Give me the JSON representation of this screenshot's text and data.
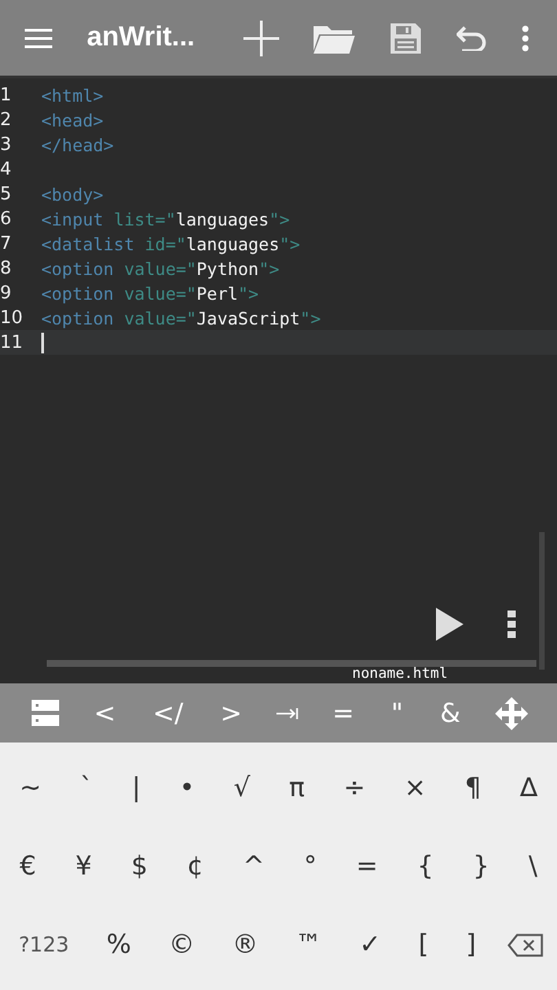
{
  "toolbar": {
    "title": "anWrit..."
  },
  "editor": {
    "lines": [
      {
        "number": "1",
        "current": false,
        "tokens": [
          {
            "kind": "tag",
            "text": "<html>"
          }
        ]
      },
      {
        "number": "2",
        "current": false,
        "tokens": [
          {
            "kind": "tag",
            "text": "<head>"
          }
        ]
      },
      {
        "number": "3",
        "current": false,
        "tokens": [
          {
            "kind": "tag",
            "text": "</head>"
          }
        ]
      },
      {
        "number": "4",
        "current": false
      },
      {
        "number": "5",
        "current": false,
        "tokens": [
          {
            "kind": "tag",
            "text": "<body>"
          }
        ]
      },
      {
        "number": "6",
        "current": false,
        "tokens": [
          {
            "kind": "tag",
            "text": "<input "
          },
          {
            "kind": "attr",
            "text": "list=\""
          },
          {
            "kind": "string",
            "text": "languages"
          },
          {
            "kind": "attr",
            "text": "\">"
          }
        ]
      },
      {
        "number": "7",
        "current": false,
        "tokens": [
          {
            "kind": "tag",
            "text": "<datalist "
          },
          {
            "kind": "attr",
            "text": "id=\""
          },
          {
            "kind": "string",
            "text": "languages"
          },
          {
            "kind": "attr",
            "text": "\">"
          }
        ]
      },
      {
        "number": "8",
        "current": false,
        "tokens": [
          {
            "kind": "tag",
            "text": "<option "
          },
          {
            "kind": "attr",
            "text": "value=\""
          },
          {
            "kind": "string",
            "text": "Python"
          },
          {
            "kind": "attr",
            "text": "\">"
          }
        ]
      },
      {
        "number": "9",
        "current": false,
        "tokens": [
          {
            "kind": "tag",
            "text": "<option "
          },
          {
            "kind": "attr",
            "text": "value=\""
          },
          {
            "kind": "string",
            "text": "Perl"
          },
          {
            "kind": "attr",
            "text": "\">"
          }
        ]
      },
      {
        "number": "10",
        "current": false,
        "tokens": [
          {
            "kind": "tag",
            "text": "<option "
          },
          {
            "kind": "attr",
            "text": "value=\""
          },
          {
            "kind": "string",
            "text": "JavaScript"
          },
          {
            "kind": "attr",
            "text": "\">"
          }
        ]
      },
      {
        "number": "11",
        "current": true
      }
    ],
    "filename": "noname.html"
  },
  "accessory_keys": [
    {
      "kind": "snippets"
    },
    {
      "kind": "text",
      "label": "<"
    },
    {
      "kind": "text",
      "label": "</"
    },
    {
      "kind": "text",
      "label": ">"
    },
    {
      "kind": "tab"
    },
    {
      "kind": "text",
      "label": "="
    },
    {
      "kind": "text",
      "label": "\""
    },
    {
      "kind": "text",
      "label": "&"
    },
    {
      "kind": "move"
    }
  ],
  "keyboard": {
    "rows": [
      [
        {
          "kind": "text",
          "label": "~"
        },
        {
          "kind": "text",
          "label": "`"
        },
        {
          "kind": "text",
          "label": "|"
        },
        {
          "kind": "text",
          "label": "•"
        },
        {
          "kind": "text",
          "label": "√"
        },
        {
          "kind": "text",
          "label": "π"
        },
        {
          "kind": "text",
          "label": "÷"
        },
        {
          "kind": "text",
          "label": "×"
        },
        {
          "kind": "text",
          "label": "¶"
        },
        {
          "kind": "text",
          "label": "∆"
        }
      ],
      [
        {
          "kind": "text",
          "label": "€"
        },
        {
          "kind": "text",
          "label": "¥"
        },
        {
          "kind": "text",
          "label": "$"
        },
        {
          "kind": "text",
          "label": "¢"
        },
        {
          "kind": "text",
          "label": "^"
        },
        {
          "kind": "text",
          "label": "°"
        },
        {
          "kind": "text",
          "label": "="
        },
        {
          "kind": "text",
          "label": "{"
        },
        {
          "kind": "text",
          "label": "}"
        },
        {
          "kind": "text",
          "label": "\\"
        }
      ],
      [
        {
          "kind": "mode",
          "label": "?123"
        },
        {
          "kind": "text",
          "label": "%"
        },
        {
          "kind": "text",
          "label": "©"
        },
        {
          "kind": "text",
          "label": "®"
        },
        {
          "kind": "text",
          "label": "™"
        },
        {
          "kind": "text",
          "label": "✓"
        },
        {
          "kind": "text",
          "label": "["
        },
        {
          "kind": "text",
          "label": "]"
        },
        {
          "kind": "backspace"
        }
      ]
    ]
  }
}
